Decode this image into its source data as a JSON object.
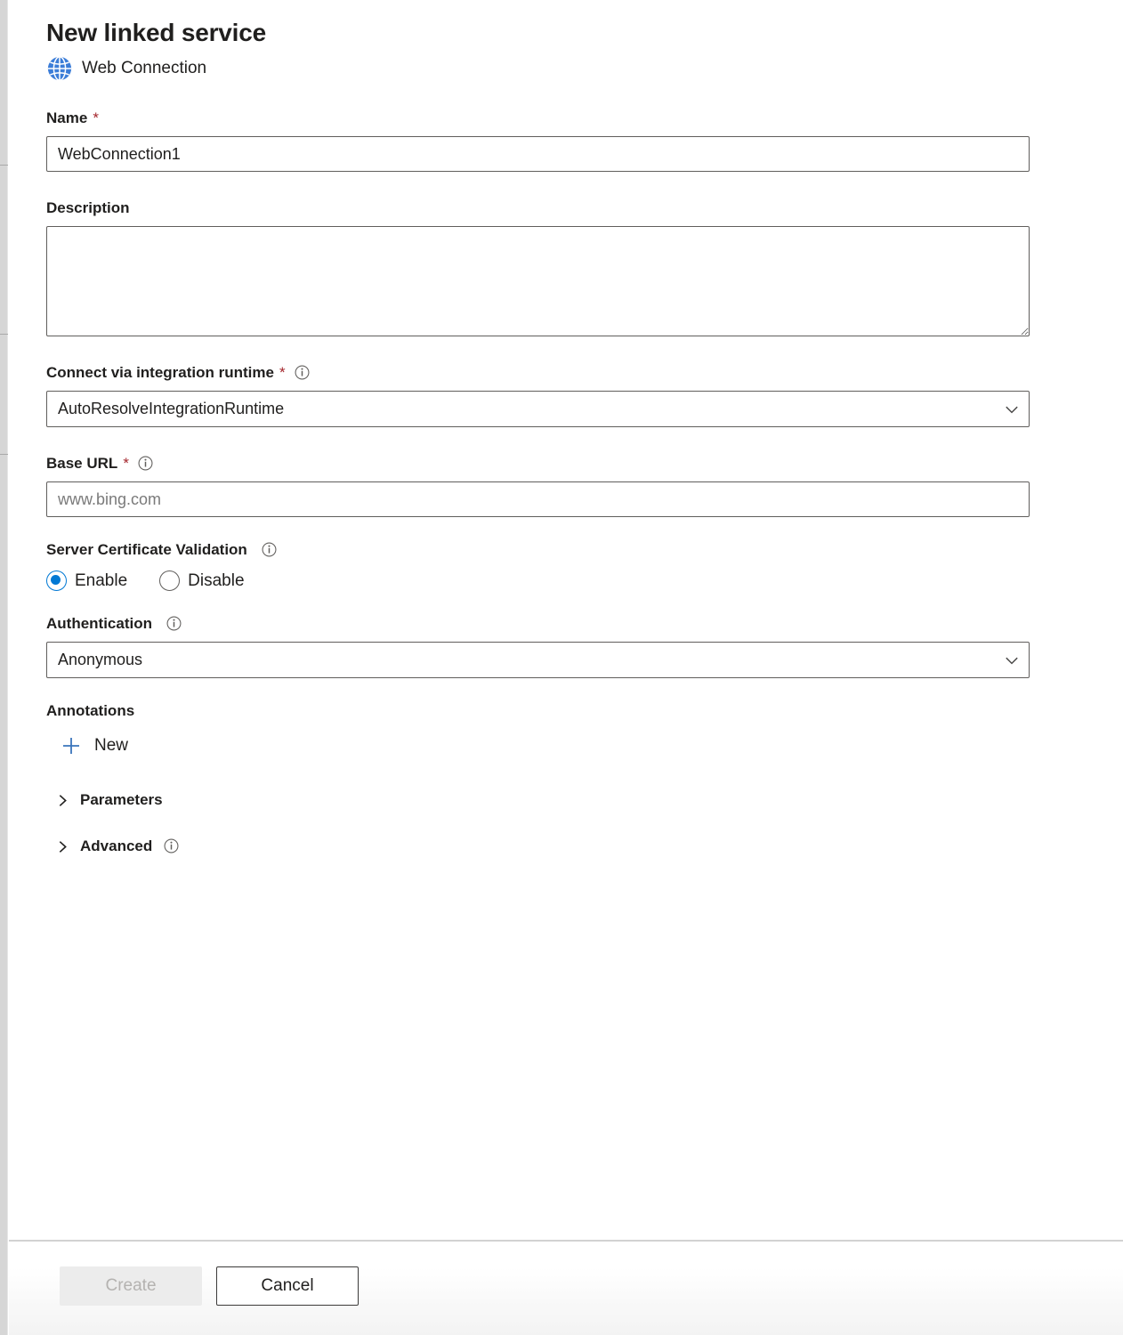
{
  "header": {
    "title": "New linked service",
    "subtitle": "Web Connection",
    "icon": "globe-icon"
  },
  "form": {
    "name": {
      "label": "Name",
      "required": "*",
      "value": "WebConnection1",
      "placeholder": ""
    },
    "description": {
      "label": "Description",
      "value": "",
      "placeholder": ""
    },
    "integration_runtime": {
      "label": "Connect via integration runtime",
      "required": "*",
      "info_icon": "info-icon",
      "value": "AutoResolveIntegrationRuntime",
      "options": [
        "AutoResolveIntegrationRuntime"
      ]
    },
    "base_url": {
      "label": "Base URL",
      "required": "*",
      "info_icon": "info-icon",
      "value": "",
      "placeholder": "www.bing.com"
    },
    "server_certificate_validation": {
      "label": "Server Certificate Validation",
      "info_icon": "info-icon",
      "selected": "Enable",
      "options": [
        {
          "label": "Enable",
          "checked": true
        },
        {
          "label": "Disable",
          "checked": false
        }
      ]
    },
    "authentication": {
      "label": "Authentication",
      "info_icon": "info-icon",
      "value": "Anonymous",
      "options": [
        "Anonymous"
      ]
    },
    "annotations": {
      "label": "Annotations",
      "new_label": "New",
      "new_icon": "plus-icon"
    },
    "sections": [
      {
        "label": "Parameters",
        "expanded": false,
        "caret": "chevron-right-icon"
      },
      {
        "label": "Advanced",
        "expanded": false,
        "caret": "chevron-right-icon",
        "info_icon": "info-icon"
      }
    ]
  },
  "footer": {
    "create_label": "Create",
    "create_disabled": true,
    "cancel_label": "Cancel"
  },
  "colors": {
    "accent": "#0078d4",
    "required_asterisk": "#a4262c",
    "text": "#201f1e",
    "border": "#605e5c",
    "placeholder": "#7a7a7a",
    "disabled_text": "#b4b2b0",
    "disabled_bg": "#ececec"
  }
}
